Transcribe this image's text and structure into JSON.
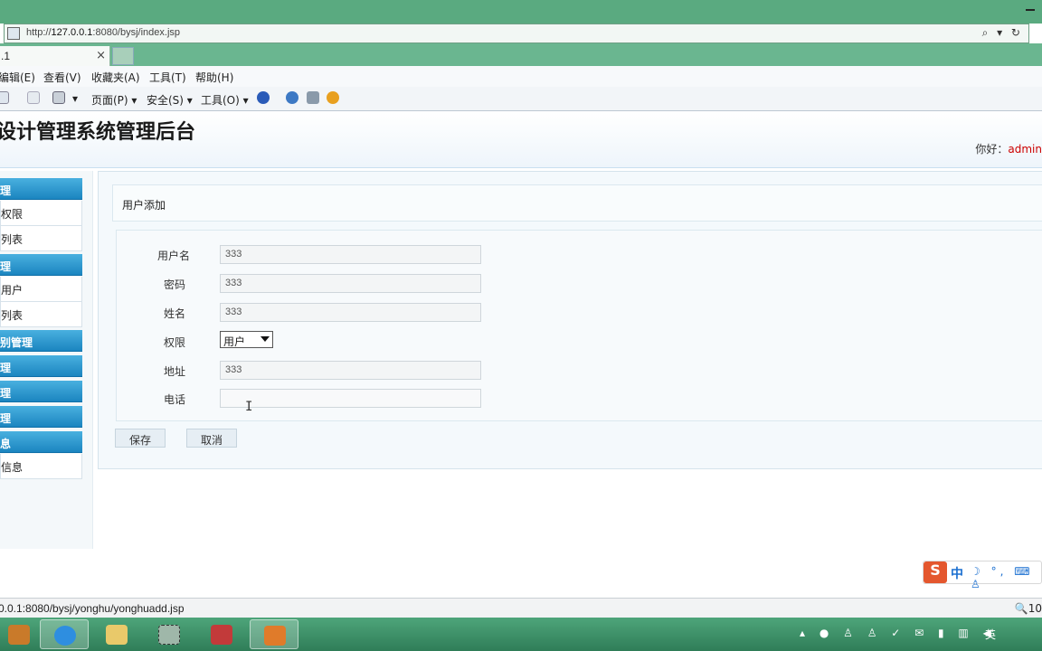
{
  "browser": {
    "url_prefix": "http://",
    "url_host": "127.0.0.1",
    "url_rest": ":8080/bysj/index.jsp",
    "address_controls": "⌕ ▾ ↻",
    "tab_title": ".1",
    "tab_close": "×",
    "menu": [
      "编辑(E)",
      "查看(V)",
      "收藏夹(A)",
      "工具(T)",
      "帮助(H)"
    ],
    "commands": [
      "页面(P) ▾",
      "安全(S) ▾",
      "工具(O) ▾"
    ]
  },
  "header": {
    "title": "设计管理系统管理后台",
    "greeting_prefix": "你好：",
    "username": "admin"
  },
  "sidebar": {
    "sections": [
      {
        "title": "理",
        "links": [
          "权限",
          "列表"
        ]
      },
      {
        "title": "理",
        "links": [
          "用户",
          "列表"
        ]
      },
      {
        "title": "别管理",
        "links": []
      },
      {
        "title": "理",
        "links": []
      },
      {
        "title": "理",
        "links": []
      },
      {
        "title": "理",
        "links": []
      },
      {
        "title": "息",
        "links": [
          "信息"
        ]
      }
    ]
  },
  "main": {
    "breadcrumb": "用户添加",
    "form": {
      "fields": [
        {
          "label": "用户名",
          "value": "333"
        },
        {
          "label": "密码",
          "value": "333"
        },
        {
          "label": "姓名",
          "value": "333"
        },
        {
          "label": "权限",
          "value": "用户",
          "type": "select"
        },
        {
          "label": "地址",
          "value": "333"
        },
        {
          "label": "电话",
          "value": ""
        }
      ],
      "save_label": "保存",
      "cancel_label": "取消"
    }
  },
  "ime": {
    "logo": "S",
    "mode": "中",
    "symbols": "☽ °, ⌨ ♙"
  },
  "statusbar": {
    "url": "0.0.1:8080/bysj/yonghu/yonghuadd.jsp",
    "zoom": "🔍10"
  },
  "taskbar": {
    "tray_language": "英"
  }
}
